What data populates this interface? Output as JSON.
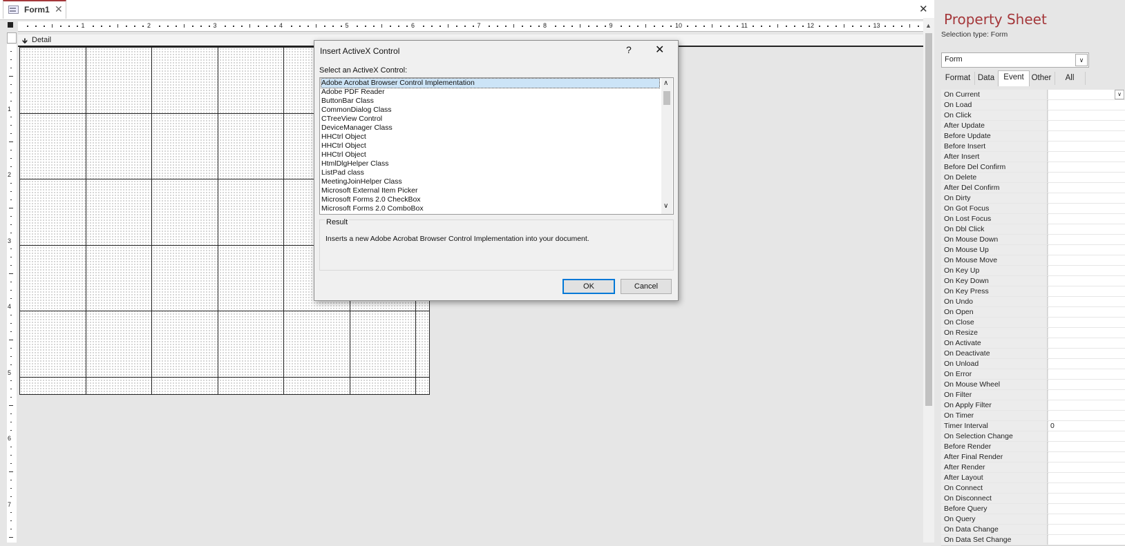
{
  "document": {
    "tab_label": "Form1",
    "detail_label": "Detail"
  },
  "ruler": {
    "horizontal": [
      "1",
      "2",
      "3",
      "4",
      "5",
      "6",
      "7",
      "8",
      "9",
      "10",
      "11",
      "12",
      "13"
    ],
    "vertical": [
      "1",
      "2",
      "3",
      "4",
      "5",
      "6",
      "7"
    ]
  },
  "dialog": {
    "title": "Insert ActiveX Control",
    "help": "?",
    "prompt": "Select an ActiveX Control:",
    "items": [
      "Adobe Acrobat Browser Control Implementation",
      "Adobe PDF Reader",
      "ButtonBar Class",
      "CommonDialog Class",
      "CTreeView Control",
      "DeviceManager Class",
      "HHCtrl Object",
      "HHCtrl Object",
      "HHCtrl Object",
      "HtmlDlgHelper Class",
      "ListPad class",
      "MeetingJoinHelper Class",
      "Microsoft External Item Picker",
      "Microsoft Forms 2.0 CheckBox",
      "Microsoft Forms 2.0 ComboBox"
    ],
    "selected_index": 0,
    "result_label": "Result",
    "result_text": "Inserts a new Adobe Acrobat Browser Control Implementation into your document.",
    "ok_label": "OK",
    "cancel_label": "Cancel"
  },
  "property_sheet": {
    "title": "Property Sheet",
    "selection_type": "Selection type:  Form",
    "object_select": "Form",
    "tabs": [
      "Format",
      "Data",
      "Event",
      "Other",
      "All"
    ],
    "active_tab": "Event",
    "rows": [
      {
        "name": "On Current",
        "value": ""
      },
      {
        "name": "On Load",
        "value": ""
      },
      {
        "name": "On Click",
        "value": ""
      },
      {
        "name": "After Update",
        "value": ""
      },
      {
        "name": "Before Update",
        "value": ""
      },
      {
        "name": "Before Insert",
        "value": ""
      },
      {
        "name": "After Insert",
        "value": ""
      },
      {
        "name": "Before Del Confirm",
        "value": ""
      },
      {
        "name": "On Delete",
        "value": ""
      },
      {
        "name": "After Del Confirm",
        "value": ""
      },
      {
        "name": "On Dirty",
        "value": ""
      },
      {
        "name": "On Got Focus",
        "value": ""
      },
      {
        "name": "On Lost Focus",
        "value": ""
      },
      {
        "name": "On Dbl Click",
        "value": ""
      },
      {
        "name": "On Mouse Down",
        "value": ""
      },
      {
        "name": "On Mouse Up",
        "value": ""
      },
      {
        "name": "On Mouse Move",
        "value": ""
      },
      {
        "name": "On Key Up",
        "value": ""
      },
      {
        "name": "On Key Down",
        "value": ""
      },
      {
        "name": "On Key Press",
        "value": ""
      },
      {
        "name": "On Undo",
        "value": ""
      },
      {
        "name": "On Open",
        "value": ""
      },
      {
        "name": "On Close",
        "value": ""
      },
      {
        "name": "On Resize",
        "value": ""
      },
      {
        "name": "On Activate",
        "value": ""
      },
      {
        "name": "On Deactivate",
        "value": ""
      },
      {
        "name": "On Unload",
        "value": ""
      },
      {
        "name": "On Error",
        "value": ""
      },
      {
        "name": "On Mouse Wheel",
        "value": ""
      },
      {
        "name": "On Filter",
        "value": ""
      },
      {
        "name": "On Apply Filter",
        "value": ""
      },
      {
        "name": "On Timer",
        "value": ""
      },
      {
        "name": "Timer Interval",
        "value": "0"
      },
      {
        "name": "On Selection Change",
        "value": ""
      },
      {
        "name": "Before Render",
        "value": ""
      },
      {
        "name": "After Final Render",
        "value": ""
      },
      {
        "name": "After Render",
        "value": ""
      },
      {
        "name": "After Layout",
        "value": ""
      },
      {
        "name": "On Connect",
        "value": ""
      },
      {
        "name": "On Disconnect",
        "value": ""
      },
      {
        "name": "Before Query",
        "value": ""
      },
      {
        "name": "On Query",
        "value": ""
      },
      {
        "name": "On Data Change",
        "value": ""
      },
      {
        "name": "On Data Set Change",
        "value": ""
      }
    ]
  }
}
